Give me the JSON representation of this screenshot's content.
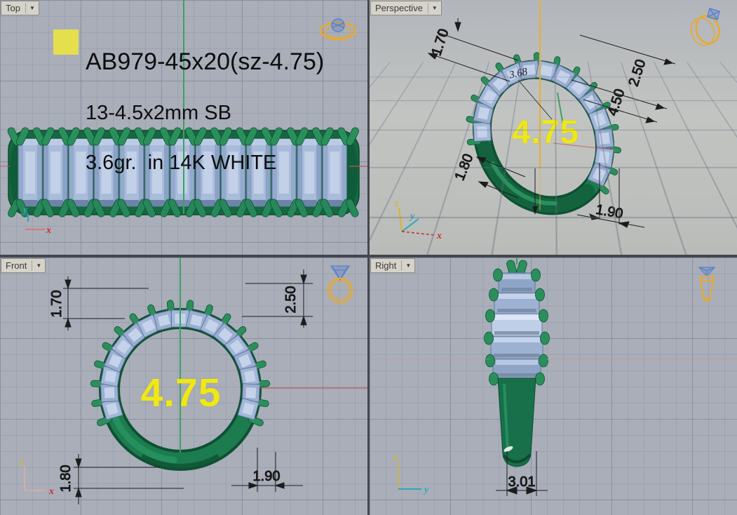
{
  "viewports": {
    "top": {
      "label": "Top"
    },
    "perspective": {
      "label": "Perspective"
    },
    "front": {
      "label": "Front"
    },
    "right": {
      "label": "Right"
    }
  },
  "annotation": {
    "swatch_color": "#e5df4e",
    "line1": "AB979-45x20(sz-4.75)",
    "line2": "13-4.5x2mm SB",
    "line3": "3.6gr.  in 14K WHITE"
  },
  "ring_size_label": "4.75",
  "dimensions": {
    "prong_height": "1.70",
    "band_top_width": "2.50",
    "stone_width": "4.50",
    "arc_length": "3.68",
    "shank_thickness": "1.80",
    "band_bottom_width": "1.90",
    "shank_width": "3.01"
  },
  "axes": {
    "x": "x",
    "y": "y",
    "z": "z"
  },
  "colors": {
    "metal_green": "#1c7c50",
    "metal_green_dark": "#0d5132",
    "stone_blue": "#9cb1d2",
    "highlight_yellow": "#f0e814",
    "axis_x_red": "#cf2b20",
    "axis_y_cyan": "#2aa8b8",
    "axis_z_yellow": "#d8b62c",
    "icon_orange": "#e9a92b",
    "icon_gem_blue": "#5b82cc"
  },
  "model": {
    "stone_count": 13,
    "stone_spec": "4.5x2mm",
    "metal": "14K WHITE",
    "weight": "3.6gr."
  }
}
